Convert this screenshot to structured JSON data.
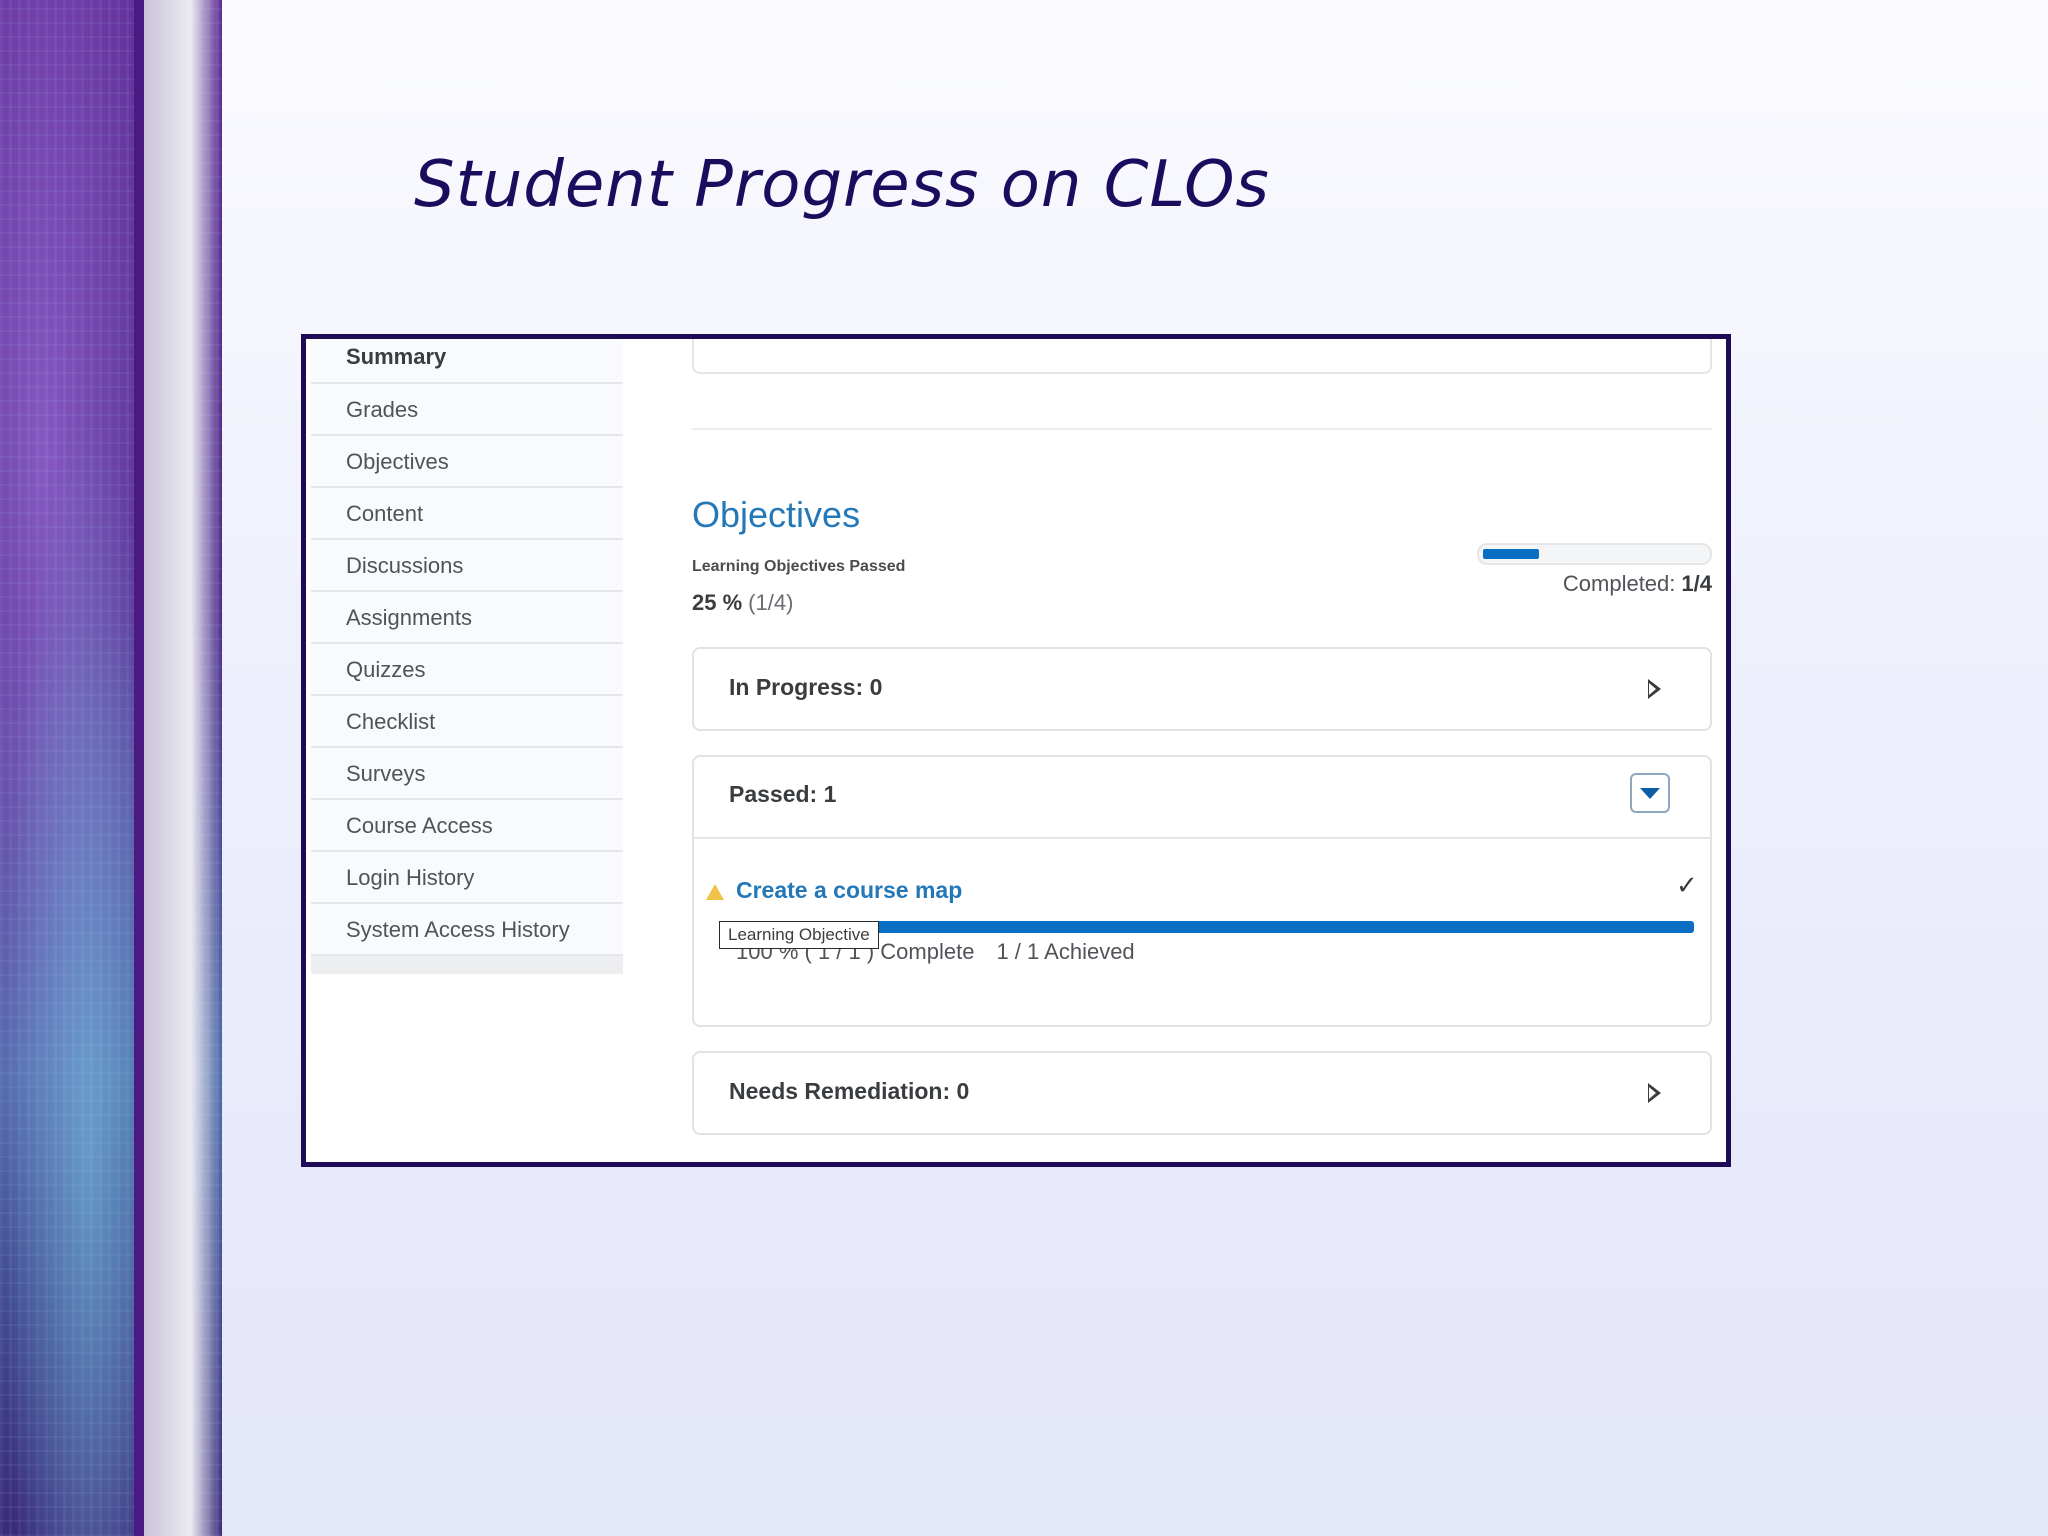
{
  "slide": {
    "title": "Student Progress on CLOs"
  },
  "sidebar": {
    "items": [
      {
        "label": "Summary"
      },
      {
        "label": "Grades"
      },
      {
        "label": "Objectives"
      },
      {
        "label": "Content"
      },
      {
        "label": "Discussions"
      },
      {
        "label": "Assignments"
      },
      {
        "label": "Quizzes"
      },
      {
        "label": "Checklist"
      },
      {
        "label": "Surveys"
      },
      {
        "label": "Course Access"
      },
      {
        "label": "Login History"
      },
      {
        "label": "System Access History"
      }
    ]
  },
  "objectives": {
    "heading": "Objectives",
    "subheading": "Learning Objectives Passed",
    "percent": "25 %",
    "fraction": "(1/4)",
    "completion_label": "Completed:",
    "completion_value": "1/4",
    "completion_fraction": 0.25
  },
  "sections": {
    "in_progress": "In Progress: 0",
    "passed": "Passed: 1",
    "needs_remediation": "Needs Remediation: 0"
  },
  "objective_item": {
    "name": "Create a course map",
    "progress_fraction": 1.0,
    "complete_text": "100 % ( 1 / 1 ) Complete",
    "achieved_text": "1 / 1 Achieved",
    "tooltip": "Learning Objective"
  },
  "icons": {
    "warning": "warning-triangle-icon",
    "check": "checkmark-icon",
    "expand": "triangle-right-icon",
    "collapse": "triangle-down-icon"
  },
  "colors": {
    "title": "#1a0d5e",
    "frame": "#1e0b56",
    "link_blue": "#2478b8",
    "bar_blue": "#0a6fc2"
  }
}
